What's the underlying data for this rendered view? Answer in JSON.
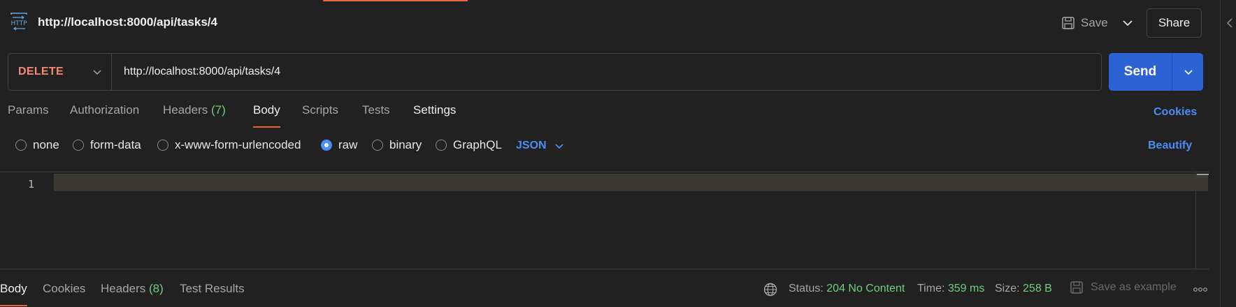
{
  "header": {
    "title": "http://localhost:8000/api/tasks/4",
    "save_label": "Save",
    "share_label": "Share"
  },
  "request": {
    "method": "DELETE",
    "url": "http://localhost:8000/api/tasks/4",
    "send_label": "Send"
  },
  "tabs": [
    {
      "label": "Params"
    },
    {
      "label": "Authorization"
    },
    {
      "label": "Headers",
      "count": "(7)"
    },
    {
      "label": "Body",
      "active": true
    },
    {
      "label": "Scripts"
    },
    {
      "label": "Tests"
    },
    {
      "label": "Settings"
    }
  ],
  "cookies_link": "Cookies",
  "body_types": {
    "options": [
      "none",
      "form-data",
      "x-www-form-urlencoded",
      "raw",
      "binary",
      "GraphQL"
    ],
    "selected": "raw",
    "format": "JSON",
    "beautify_label": "Beautify"
  },
  "editor": {
    "line_numbers": [
      "1"
    ],
    "content": ""
  },
  "response": {
    "tabs": [
      {
        "label": "Body",
        "active": true
      },
      {
        "label": "Cookies"
      },
      {
        "label": "Headers",
        "count": "(8)"
      },
      {
        "label": "Test Results"
      }
    ],
    "status_label": "Status:",
    "status_value": "204 No Content",
    "time_label": "Time:",
    "time_value": "359 ms",
    "size_label": "Size:",
    "size_value": "258 B",
    "save_example_label": "Save as example"
  },
  "colors": {
    "background": "#212121",
    "accent_orange": "#e8623a",
    "method_delete": "#f28b73",
    "primary_blue": "#2d62d5",
    "link_blue": "#4b8ef5",
    "success_green": "#6fcf7c"
  },
  "icons": [
    "http-icon",
    "save-icon",
    "chevron-down-icon",
    "globe-icon",
    "more-icon",
    "chevron-left-icon"
  ]
}
